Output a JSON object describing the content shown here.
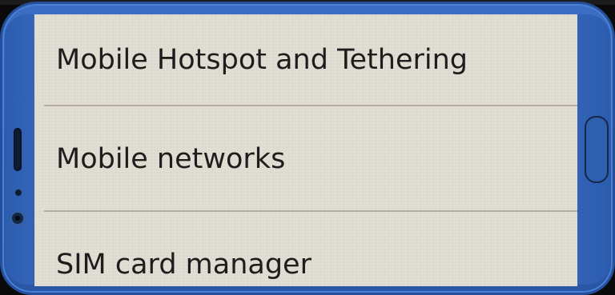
{
  "settings_list": {
    "items": [
      {
        "label": "Mobile Hotspot and Tethering"
      },
      {
        "label": "Mobile networks"
      },
      {
        "label": "SIM card manager"
      }
    ]
  },
  "colors": {
    "phone_frame": "#2f5fb3",
    "screen_background": "#e1ddd3",
    "text": "#1d1d1d",
    "divider": "#b3aea5"
  },
  "icons": {
    "speaker": "earpiece-speaker-icon",
    "sensor": "proximity-sensor-icon",
    "camera": "front-camera-icon",
    "home": "home-button-icon"
  }
}
